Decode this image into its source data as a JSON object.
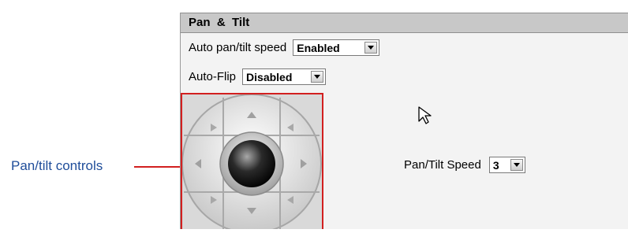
{
  "callout": {
    "label": "Pan/tilt controls"
  },
  "panel": {
    "header": {
      "title": "Pan  &  Tilt"
    },
    "auto_speed": {
      "label": "Auto pan/tilt speed",
      "value": "Enabled"
    },
    "auto_flip": {
      "label": "Auto-Flip",
      "value": "Disabled"
    },
    "speed": {
      "label": "Pan/Tilt Speed",
      "value": "3"
    }
  },
  "icons": {
    "up": "arrow-up-icon",
    "down": "arrow-down-icon",
    "left": "arrow-left-icon",
    "right": "arrow-right-icon",
    "center": "home-knob-icon",
    "cursor": "mouse-pointer-icon"
  },
  "colors": {
    "callout_text": "#1f4d9a",
    "callout_line": "#d21f1f",
    "header_bg": "#c8c8c8"
  }
}
